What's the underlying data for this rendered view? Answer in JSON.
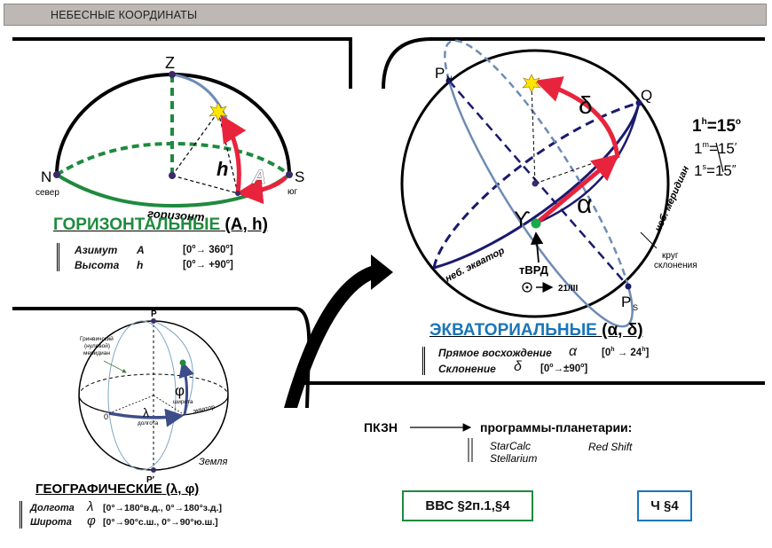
{
  "title": "НЕБЕСНЫЕ КООРДИНАТЫ",
  "horizontal": {
    "zenith": "Z",
    "north": "N",
    "north_caption": "север",
    "south": "S",
    "south_caption": "юг",
    "altitude_symbol": "h",
    "azimuth_symbol": "A",
    "horizon_caption": "горизонт",
    "heading": "ГОРИЗОНТАЛЬНЫЕ",
    "heading_suffix": "(A, h)",
    "rows": [
      {
        "name": "Азимут",
        "symbol": "A",
        "range_start": "[0",
        "range_end": "360",
        "range_close": "]"
      },
      {
        "name": "Высота",
        "symbol": "h",
        "range_start": "[0",
        "range_end": "+90",
        "range_close": "]"
      }
    ],
    "degree": "o"
  },
  "equatorial": {
    "north_pole": "P",
    "north_pole_sub": "N",
    "south_pole": "P",
    "south_pole_sub": "S",
    "q_point": "Q",
    "delta": "δ",
    "alpha": "α",
    "aries": "ϒ",
    "vernal_point": "тВРД",
    "date": "21/III",
    "equator_caption": "неб. экватор",
    "meridian_caption": "неб. меридиан",
    "declination_circle": [
      "круг",
      "склонения"
    ],
    "heading": "ЭКВАТОРИАЛЬНЫЕ",
    "heading_suffix": "(α, δ)",
    "rows": [
      {
        "name": "Прямое восхождение",
        "symbol": "α",
        "range_start": "[0",
        "range_start_sup": "h",
        "range_end": "24",
        "range_end_sup": "h",
        "range_close": "]"
      },
      {
        "name": "Склонение",
        "symbol": "δ",
        "range_start": "[0",
        "range_start_sup": "o",
        "range_end": "±90",
        "range_end_sup": "o",
        "range_close": "]"
      }
    ],
    "conversions": [
      {
        "lhs": "1",
        "sup": "h",
        "rhs": "=15",
        "rhs_sup": "o"
      },
      {
        "lhs": "1",
        "sup": "m",
        "rhs": "=15",
        "rhs_sup": "′"
      },
      {
        "lhs": "1",
        "sup": "s",
        "rhs": "=15",
        "rhs_sup": "″"
      }
    ]
  },
  "geographic": {
    "north_pole": "P",
    "south_pole": "P′",
    "meridian_label": [
      "Гринвичский",
      "(нулевой)",
      "меридиан"
    ],
    "phi": "φ",
    "latitude": "широта",
    "lambda": "λ",
    "longitude": "долгота",
    "equator": "экватор",
    "zero": "0",
    "earth": "Земля",
    "heading": "ГЕОГРАФИЧЕСКИЕ",
    "heading_suffix": "(λ, φ)",
    "rows": [
      {
        "name": "Долгота",
        "symbol": "λ",
        "range": "[0°→180°в.д., 0°→180°з.д.]"
      },
      {
        "name": "Широта",
        "symbol": "φ",
        "range": "[0°→90°с.ш., 0°→90°ю.ш.]"
      }
    ]
  },
  "planetarium": {
    "source": "ПКЗН",
    "target": "программы-планетарии:",
    "programs": [
      "StarCalc",
      "Stellarium",
      "Red Shift"
    ]
  },
  "refs": {
    "vvs": "ВВС §2п.1,§4",
    "ch": "Ч §4"
  },
  "colors": {
    "red_arrow": "#e8243c",
    "blue_line": "#6f8bb5",
    "green": "#1f8a3e",
    "navy": "#1a1a6e",
    "heading_green": "#1e8b3d",
    "heading_blue": "#1976b8",
    "title_bar": "#bdb8b3"
  }
}
